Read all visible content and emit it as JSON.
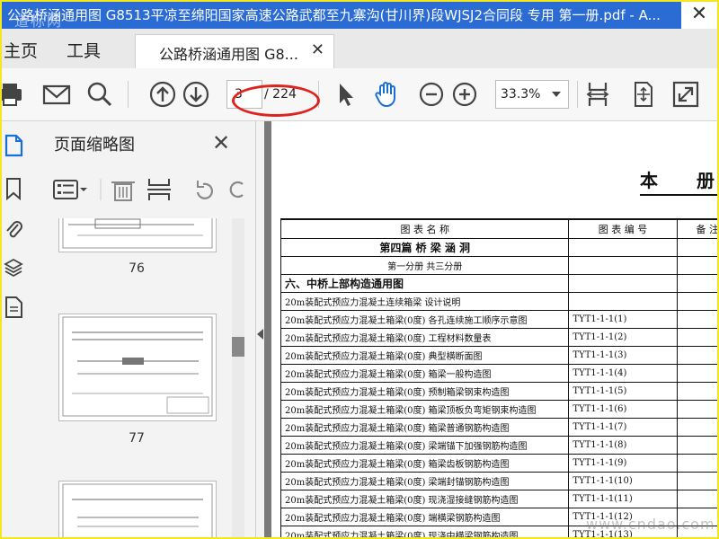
{
  "window": {
    "title": "公路桥涵通用图 G8513平凉至绵阳国家高速公路武都至九寨沟(甘川界)段WJSJ2合同段 专用 第一册.pdf - A...",
    "close_glyph": "✕",
    "watermark": "道标网"
  },
  "menu": {
    "home": "主页",
    "tools": "工具"
  },
  "tab": {
    "label": "公路桥涵通用图 G8...",
    "close": "✕"
  },
  "toolbar": {
    "current_page": "3",
    "total_pages": "/ 224",
    "zoom": "33.3%"
  },
  "panel": {
    "title": "页面缩略图",
    "close": "✕",
    "thumb_numbers": [
      "76",
      "77"
    ]
  },
  "document": {
    "big_title": "本  册",
    "headers": [
      "图  表  名  称",
      "图 表 编 号",
      "备 注"
    ],
    "rows": [
      {
        "name": "第四篇  桥 梁 涵 洞",
        "code": "",
        "style": "section"
      },
      {
        "name": "第一分册   共三分册",
        "code": "",
        "style": "sub"
      },
      {
        "name": "六、中桥上部构造通用图",
        "code": "",
        "style": "part"
      },
      {
        "name": "20m装配式预应力混凝土连续箱梁  设计说明",
        "code": "",
        "style": "item"
      },
      {
        "name": "20m装配式预应力混凝土箱梁(0度)  各孔连续施工顺序示意图",
        "code": "TYT1-1-1(1)",
        "style": "item"
      },
      {
        "name": "20m装配式预应力混凝土箱梁(0度)  工程材料数量表",
        "code": "TYT1-1-1(2)",
        "style": "item"
      },
      {
        "name": "20m装配式预应力混凝土箱梁(0度)  典型横断面图",
        "code": "TYT1-1-1(3)",
        "style": "item"
      },
      {
        "name": "20m装配式预应力混凝土箱梁(0度)  箱梁一般构造图",
        "code": "TYT1-1-1(4)",
        "style": "item"
      },
      {
        "name": "20m装配式预应力混凝土箱梁(0度)  预制箱梁钢束构造图",
        "code": "TYT1-1-1(5)",
        "style": "item"
      },
      {
        "name": "20m装配式预应力混凝土箱梁(0度)  箱梁顶板负弯矩钢束构造图",
        "code": "TYT1-1-1(6)",
        "style": "item"
      },
      {
        "name": "20m装配式预应力混凝土箱梁(0度)  箱梁普通钢筋构造图",
        "code": "TYT1-1-1(7)",
        "style": "item"
      },
      {
        "name": "20m装配式预应力混凝土箱梁(0度)  梁端锚下加强钢筋构造图",
        "code": "TYT1-1-1(8)",
        "style": "item"
      },
      {
        "name": "20m装配式预应力混凝土箱梁(0度)  箱梁齿板钢筋构造图",
        "code": "TYT1-1-1(9)",
        "style": "item"
      },
      {
        "name": "20m装配式预应力混凝土箱梁(0度)  梁端封锚钢筋构造图",
        "code": "TYT1-1-1(10)",
        "style": "item"
      },
      {
        "name": "20m装配式预应力混凝土箱梁(0度)  现浇湿接缝钢筋构造图",
        "code": "TYT1-1-1(11)",
        "style": "item"
      },
      {
        "name": "20m装配式预应力混凝土箱梁(0度)  端横梁钢筋构造图",
        "code": "TYT1-1-1(12)",
        "style": "item"
      },
      {
        "name": "20m装配式预应力混凝土箱梁(0度)  现浇中横梁钢筋构造图",
        "code": "TYT1-1-1(13)",
        "style": "item"
      }
    ],
    "site_watermark": "www.cndao.com"
  }
}
